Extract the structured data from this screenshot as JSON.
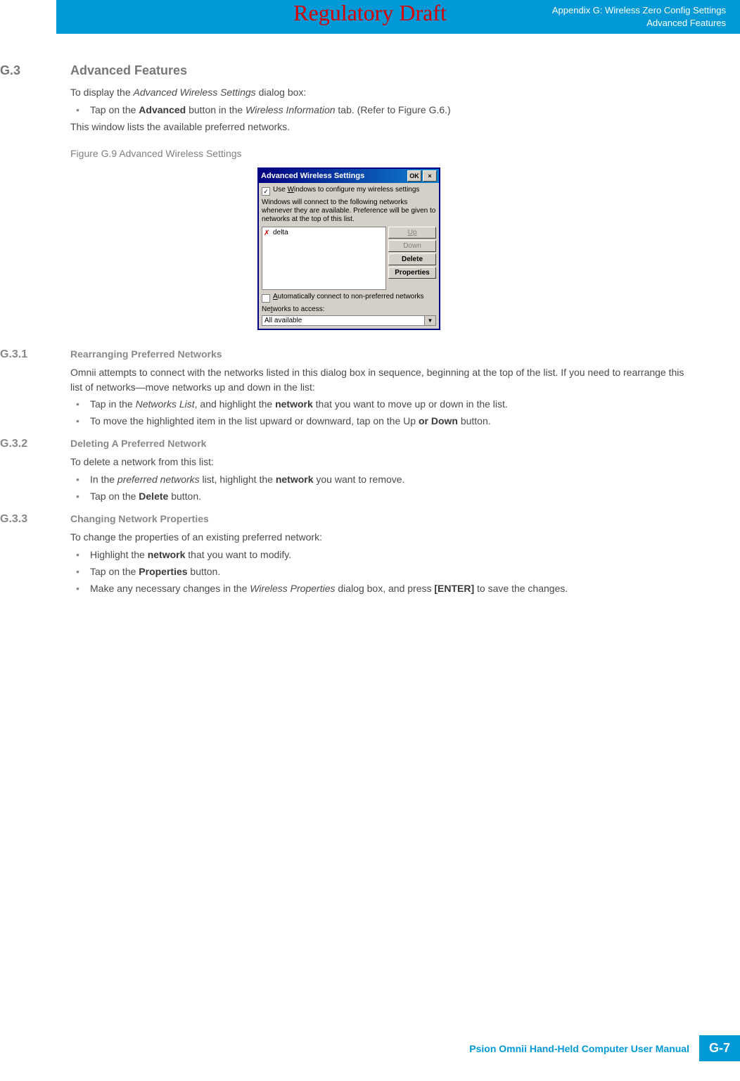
{
  "watermark": "Regulatory Draft",
  "header": {
    "line1": "Appendix G: Wireless Zero Config Settings",
    "line2": "Advanced Features"
  },
  "g3": {
    "num": "G.3",
    "title": "Advanced Features",
    "p1a": "To display the ",
    "p1b": "Advanced Wireless Settings",
    "p1c": " dialog box:",
    "li1a": "Tap on the ",
    "li1b": "Advanced",
    "li1c": " button in the ",
    "li1d": "Wireless Information",
    "li1e": " tab. (Refer to Figure G.6.)",
    "p2": "This window lists the available preferred networks."
  },
  "figure": {
    "caption": "Figure G.9    Advanced Wireless Settings"
  },
  "dialog": {
    "title": "Advanced Wireless Settings",
    "ok": "OK",
    "close": "×",
    "chk1_mark": "✓",
    "chk1a": "Use ",
    "chk1b": "W",
    "chk1c": "indows to configure my wireless settings",
    "info": "Windows will connect to the following networks whenever they are available. Preference will be given to networks at the top of this list.",
    "network_item": "delta",
    "btn_up": "Up",
    "btn_down": "Down",
    "btn_delete": "Delete",
    "btn_properties": "Properties",
    "chk2a": "A",
    "chk2b": "utomatically connect to non-preferred networks",
    "label_access_a": "Ne",
    "label_access_b": "t",
    "label_access_c": "works to access:",
    "dropdown_value": "All available"
  },
  "g31": {
    "num": "G.3.1",
    "title": "Rearranging Preferred Networks",
    "p1": "Omnii attempts to connect with the networks listed in this dialog box in sequence, beginning at the top of the list. If you need to rearrange this list of networks—move networks up and down in the list:",
    "li1a": "Tap in the ",
    "li1b": "Networks List",
    "li1c": ", and highlight the ",
    "li1d": "network",
    "li1e": " that you want to move up or down in the list.",
    "li2a": "To move the highlighted item in the list upward or downward, tap on the Up ",
    "li2b": "or Down",
    "li2c": " button."
  },
  "g32": {
    "num": "G.3.2",
    "title": "Deleting A Preferred Network",
    "p1": "To delete a network from this list:",
    "li1a": "In the ",
    "li1b": "preferred networks",
    "li1c": " list, highlight the ",
    "li1d": "network",
    "li1e": " you want to remove.",
    "li2a": "Tap on the ",
    "li2b": "Delete",
    "li2c": " button."
  },
  "g33": {
    "num": "G.3.3",
    "title": "Changing Network Properties",
    "p1": "To change the properties of an existing preferred network:",
    "li1a": "Highlight the ",
    "li1b": "network",
    "li1c": " that you want to modify.",
    "li2a": "Tap on the ",
    "li2b": "Properties",
    "li2c": " button.",
    "li3a": "Make any necessary changes in the ",
    "li3b": "Wireless Properties",
    "li3c": " dialog box, and press ",
    "li3d": "[ENTER]",
    "li3e": " to save the changes."
  },
  "footer": {
    "text": "Psion Omnii Hand-Held Computer User Manual",
    "page": "G-7"
  }
}
